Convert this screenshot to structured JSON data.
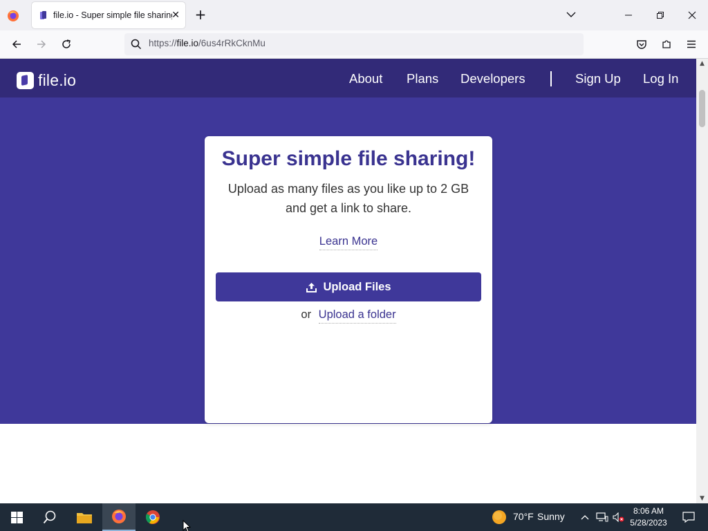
{
  "browser": {
    "tab_title": "file.io - Super simple file sharing",
    "url_prefix": "https://",
    "url_host": "file.io",
    "url_path": "/6us4rRkCknMu"
  },
  "site": {
    "logo_text": "file.io",
    "nav": {
      "about": "About",
      "plans": "Plans",
      "developers": "Developers",
      "signup": "Sign Up",
      "login": "Log In"
    }
  },
  "card": {
    "title": "Super simple file sharing!",
    "subtitle_line1": "Upload as many files as you like up to 2 GB",
    "subtitle_line2": "and get a link to share.",
    "learn_more": "Learn More",
    "upload_files": "Upload Files",
    "or_text": "or",
    "upload_folder": "Upload a folder"
  },
  "taskbar": {
    "weather_temp": "70°F",
    "weather_cond": "Sunny",
    "time": "8:06 AM",
    "date": "5/28/2023"
  },
  "colors": {
    "brand_dark": "#322a78",
    "brand": "#3f389a",
    "accent_text": "#3a3390"
  }
}
